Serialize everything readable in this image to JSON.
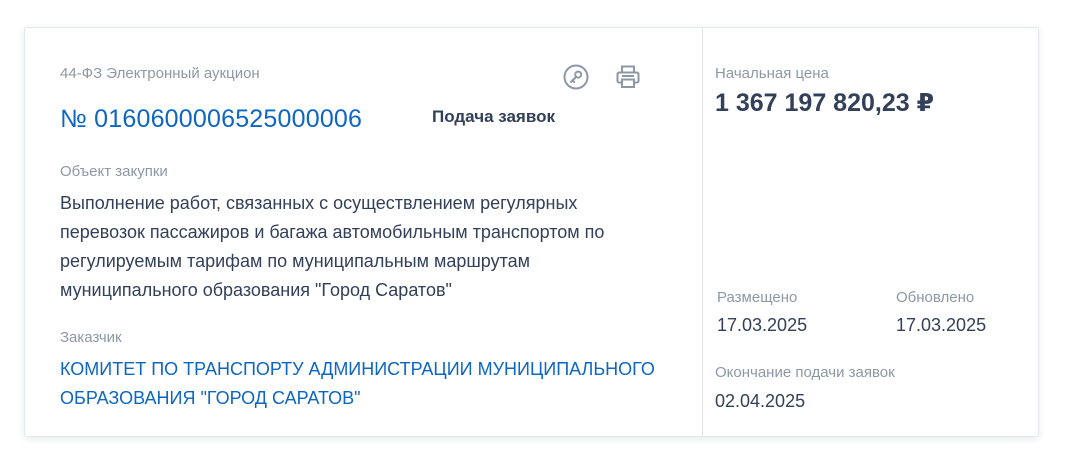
{
  "procurement": {
    "law_type": "44-ФЗ Электронный аукцион",
    "number": "№ 0160600006525000006",
    "stage": "Подача заявок",
    "object_label": "Объект закупки",
    "object_text": "Выполнение работ, связанных с осуществлением регулярных перевозок пассажиров и багажа автомобильным транспортом по регулируемым тарифам по муниципальным маршрутам муниципального образования \"Город Саратов\"",
    "customer_label": "Заказчик",
    "customer_name": "КОМИТЕТ ПО ТРАНСПОРТУ АДМИНИСТРАЦИИ МУНИЦИПАЛЬНОГО ОБРАЗОВАНИЯ \"ГОРОД САРАТОВ\""
  },
  "icons": {
    "key": "key-icon",
    "print": "print-icon"
  },
  "price": {
    "label": "Начальная цена",
    "value": "1 367 197 820,23 ₽"
  },
  "dates": {
    "posted_label": "Размещено",
    "posted_value": "17.03.2025",
    "updated_label": "Обновлено",
    "updated_value": "17.03.2025",
    "end_label": "Окончание подачи заявок",
    "end_value": "02.04.2025"
  },
  "colors": {
    "accent": "#0d66c2",
    "text": "#334059",
    "muted": "#8d98a6",
    "icon": "#8d98a6"
  }
}
